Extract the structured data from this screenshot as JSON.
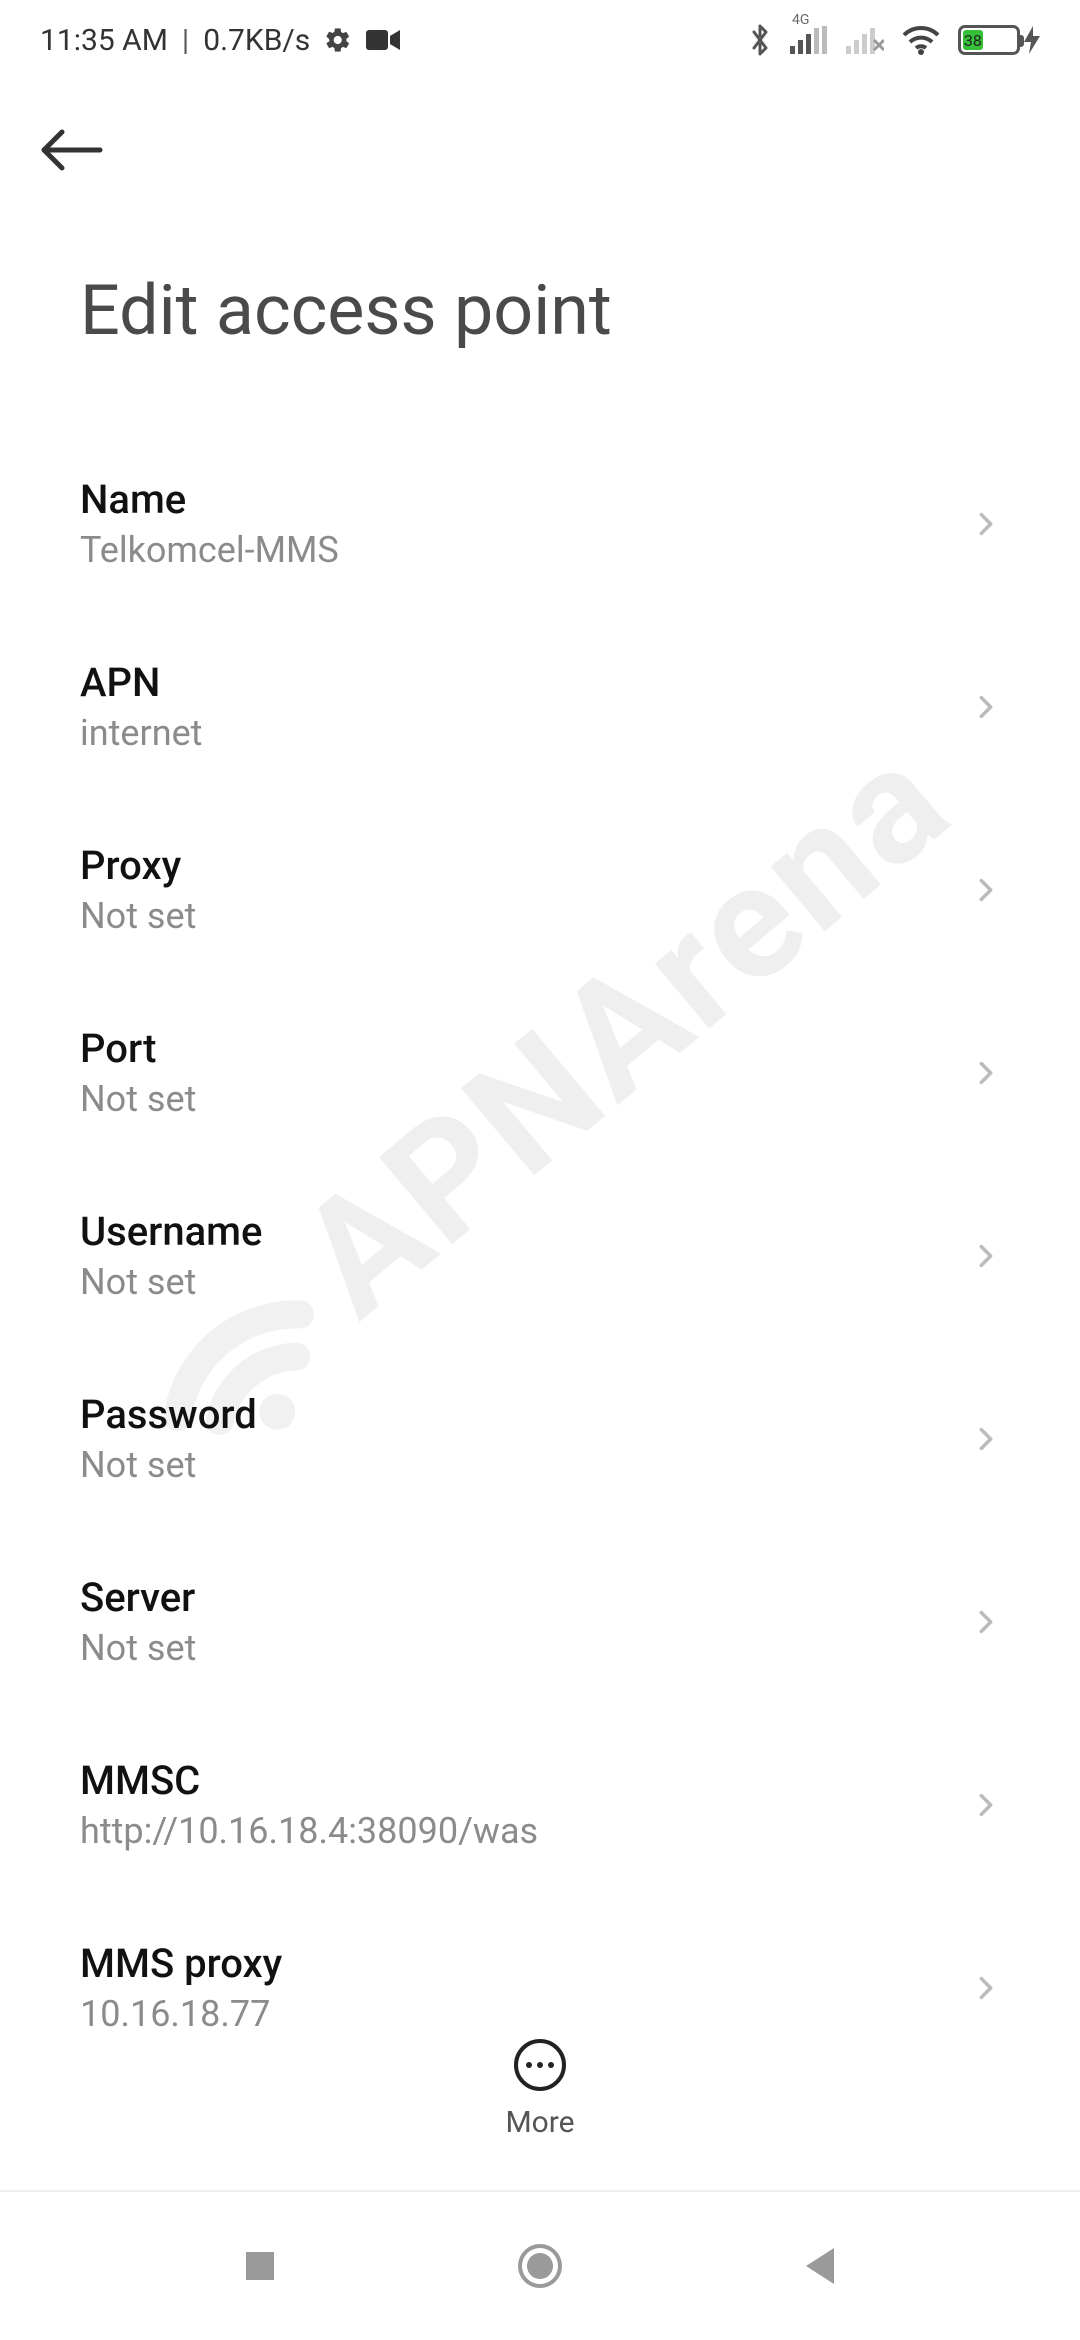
{
  "statusbar": {
    "time": "11:35 AM",
    "net_speed": "0.7KB/s",
    "mobile_data_label": "4G",
    "battery_pct": "38"
  },
  "header": {
    "title": "Edit access point"
  },
  "rows": [
    {
      "title": "Name",
      "value": "Telkomcel-MMS"
    },
    {
      "title": "APN",
      "value": "internet"
    },
    {
      "title": "Proxy",
      "value": "Not set"
    },
    {
      "title": "Port",
      "value": "Not set"
    },
    {
      "title": "Username",
      "value": "Not set"
    },
    {
      "title": "Password",
      "value": "Not set"
    },
    {
      "title": "Server",
      "value": "Not set"
    },
    {
      "title": "MMSC",
      "value": "http://10.16.18.4:38090/was"
    },
    {
      "title": "MMS proxy",
      "value": "10.16.18.77"
    }
  ],
  "bottom": {
    "more_label": "More"
  },
  "watermark": {
    "text": "APNArena"
  }
}
